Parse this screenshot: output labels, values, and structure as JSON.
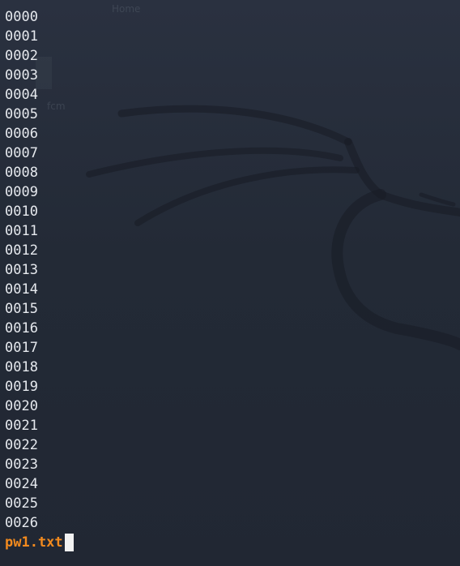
{
  "terminal": {
    "lines": [
      "0000",
      "0001",
      "0002",
      "0003",
      "0004",
      "0005",
      "0006",
      "0007",
      "0008",
      "0009",
      "0010",
      "0011",
      "0012",
      "0013",
      "0014",
      "0015",
      "0016",
      "0017",
      "0018",
      "0019",
      "0020",
      "0021",
      "0022",
      "0023",
      "0024",
      "0025",
      "0026"
    ],
    "prompt_text": "pw1.txt"
  },
  "background": {
    "ghost_home": "Home",
    "ghost_fcm": "fcm"
  },
  "colors": {
    "background": "#232a36",
    "text": "#e6e9ee",
    "prompt": "#f28a1e",
    "cursor": "#f2f2f2"
  }
}
